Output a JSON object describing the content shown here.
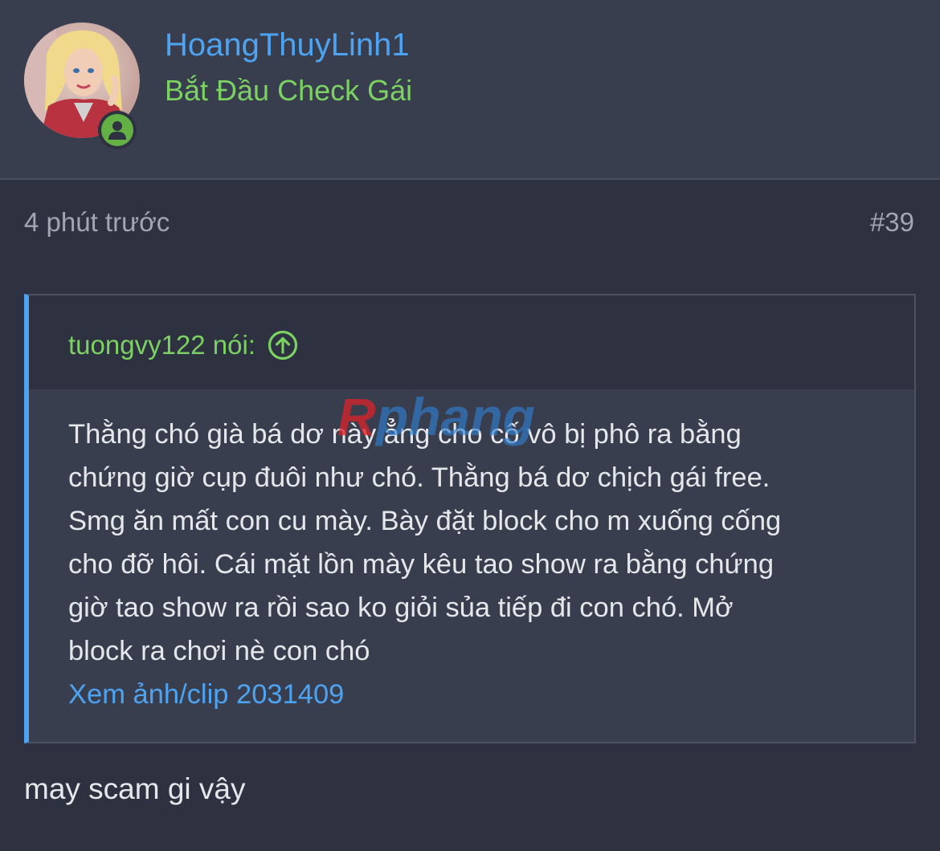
{
  "post": {
    "username": "HoangThuyLinh1",
    "user_title": "Bắt Đầu Check Gái",
    "time": "4 phút trước",
    "number": "#39",
    "online_status_icon": "user-online-icon"
  },
  "quote": {
    "author": "tuongvy122 nói:",
    "jump_icon": "arrow-up-circle-icon",
    "lines": [
      "Thằng chó già bá dơ này ẳng cho cố vô bị phô ra bằng",
      "chứng giờ cụp đuôi như chó. Thằng bá dơ chịch gái free.",
      "Smg ăn mất con cu mày. Bày đặt block cho m xuống cống",
      "cho đỡ hôi. Cái mặt lồn mày kêu tao show ra bằng chứng",
      "giờ tao show ra rồi sao ko giỏi sủa tiếp đi con chó. Mở",
      "block ra chơi nè con chó"
    ],
    "media_link": "Xem ảnh/clip 2031409"
  },
  "reply_text": "may scam gi vậy",
  "watermark": "Rphang",
  "colors": {
    "background": "#2d3140",
    "header_bg": "#393e4f",
    "username": "#4ea3f0",
    "user_title": "#7bd162",
    "quote_accent": "#4ea3f0",
    "online": "#63b044"
  }
}
